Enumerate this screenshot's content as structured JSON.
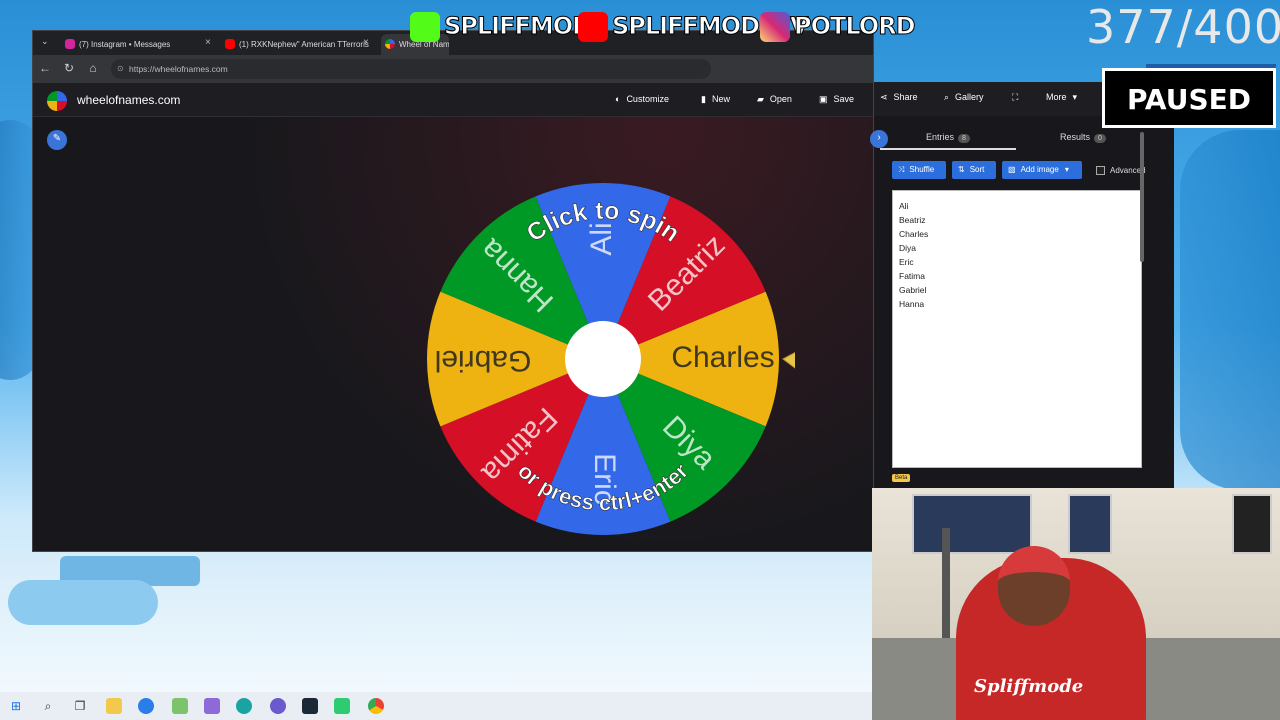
{
  "overlay": {
    "promos": [
      {
        "label": "SPLIFFMODE",
        "icon": "kick-logo-icon",
        "color": "#53fc18"
      },
      {
        "label": "SPLIFFMODETV",
        "icon": "youtube-logo-icon",
        "color": "#ff0000"
      },
      {
        "label": "POTLORD",
        "icon": "instagram-logo-icon",
        "color": "#e1306c"
      }
    ],
    "counter": "377/400",
    "status": "PAUSED"
  },
  "browser": {
    "tabs": [
      {
        "label": "(7) Instagram • Messages",
        "icon": "instagram-icon"
      },
      {
        "label": "(1) RXKNephew\" American TTerroris",
        "icon": "youtube-icon"
      },
      {
        "label": "Wheel of Names",
        "icon": "wheel-icon"
      }
    ],
    "url": "https://wheelofnames.com"
  },
  "site": {
    "brand": "wheelofnames.com",
    "nav": [
      {
        "label": "Customize",
        "icon": "palette-icon"
      },
      {
        "label": "New",
        "icon": "new-file-icon"
      },
      {
        "label": "Open",
        "icon": "folder-icon"
      },
      {
        "label": "Save",
        "icon": "save-icon"
      },
      {
        "label": "Share",
        "icon": "share-icon"
      },
      {
        "label": "Gallery",
        "icon": "search-icon"
      },
      {
        "label": "",
        "icon": "fullscreen-icon"
      },
      {
        "label": "More",
        "icon": "chevron-down-icon"
      }
    ]
  },
  "wheel": {
    "slices": [
      "Charles",
      "Diya",
      "Eric",
      "Fatima",
      "Gabriel",
      "Hanna",
      "Ali",
      "Beatriz"
    ],
    "colors": [
      "#eeb211",
      "#009925",
      "#3369e8",
      "#d50f25"
    ],
    "prompt_top": "Click to spin",
    "prompt_bottom": "or press ctrl+enter"
  },
  "panel": {
    "entries_label": "Entries",
    "entries_count": "8",
    "results_label": "Results",
    "results_count": "0",
    "shuffle_label": "Shuffle",
    "sort_label": "Sort",
    "add_image_label": "Add image",
    "advanced_label": "Advanced",
    "entries": [
      "Ali",
      "Beatriz",
      "Charles",
      "Diya",
      "Eric",
      "Fatima",
      "Gabriel",
      "Hanna"
    ],
    "beta_label": "Beta"
  },
  "webcam": {
    "shirt_text": "Spliffmode"
  }
}
